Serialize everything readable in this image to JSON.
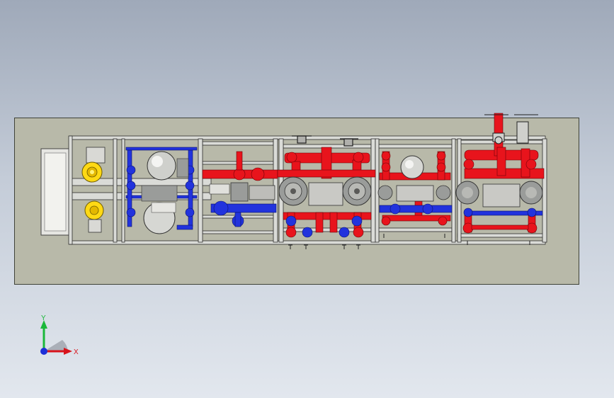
{
  "viewport": {
    "background_top": "#9fa9b9",
    "background_bottom": "#e2e7ee",
    "plate_color": "#b8b9a9"
  },
  "model": {
    "hot_pipe_color": "#e8141c",
    "cold_pipe_color": "#2233dd",
    "frame_color": "#dadbd7",
    "valve_color": "#9a9c9a",
    "flange_color": "#c2c0ba",
    "yellow_flange_color": "#ffd914"
  },
  "triad": {
    "x_label": "X",
    "y_label": "Y",
    "x_axis_color": "#d8141c",
    "y_axis_color": "#1bb83a",
    "z_axis_color": "#1d2fd8",
    "icon": "coordinate-triad-icon"
  }
}
